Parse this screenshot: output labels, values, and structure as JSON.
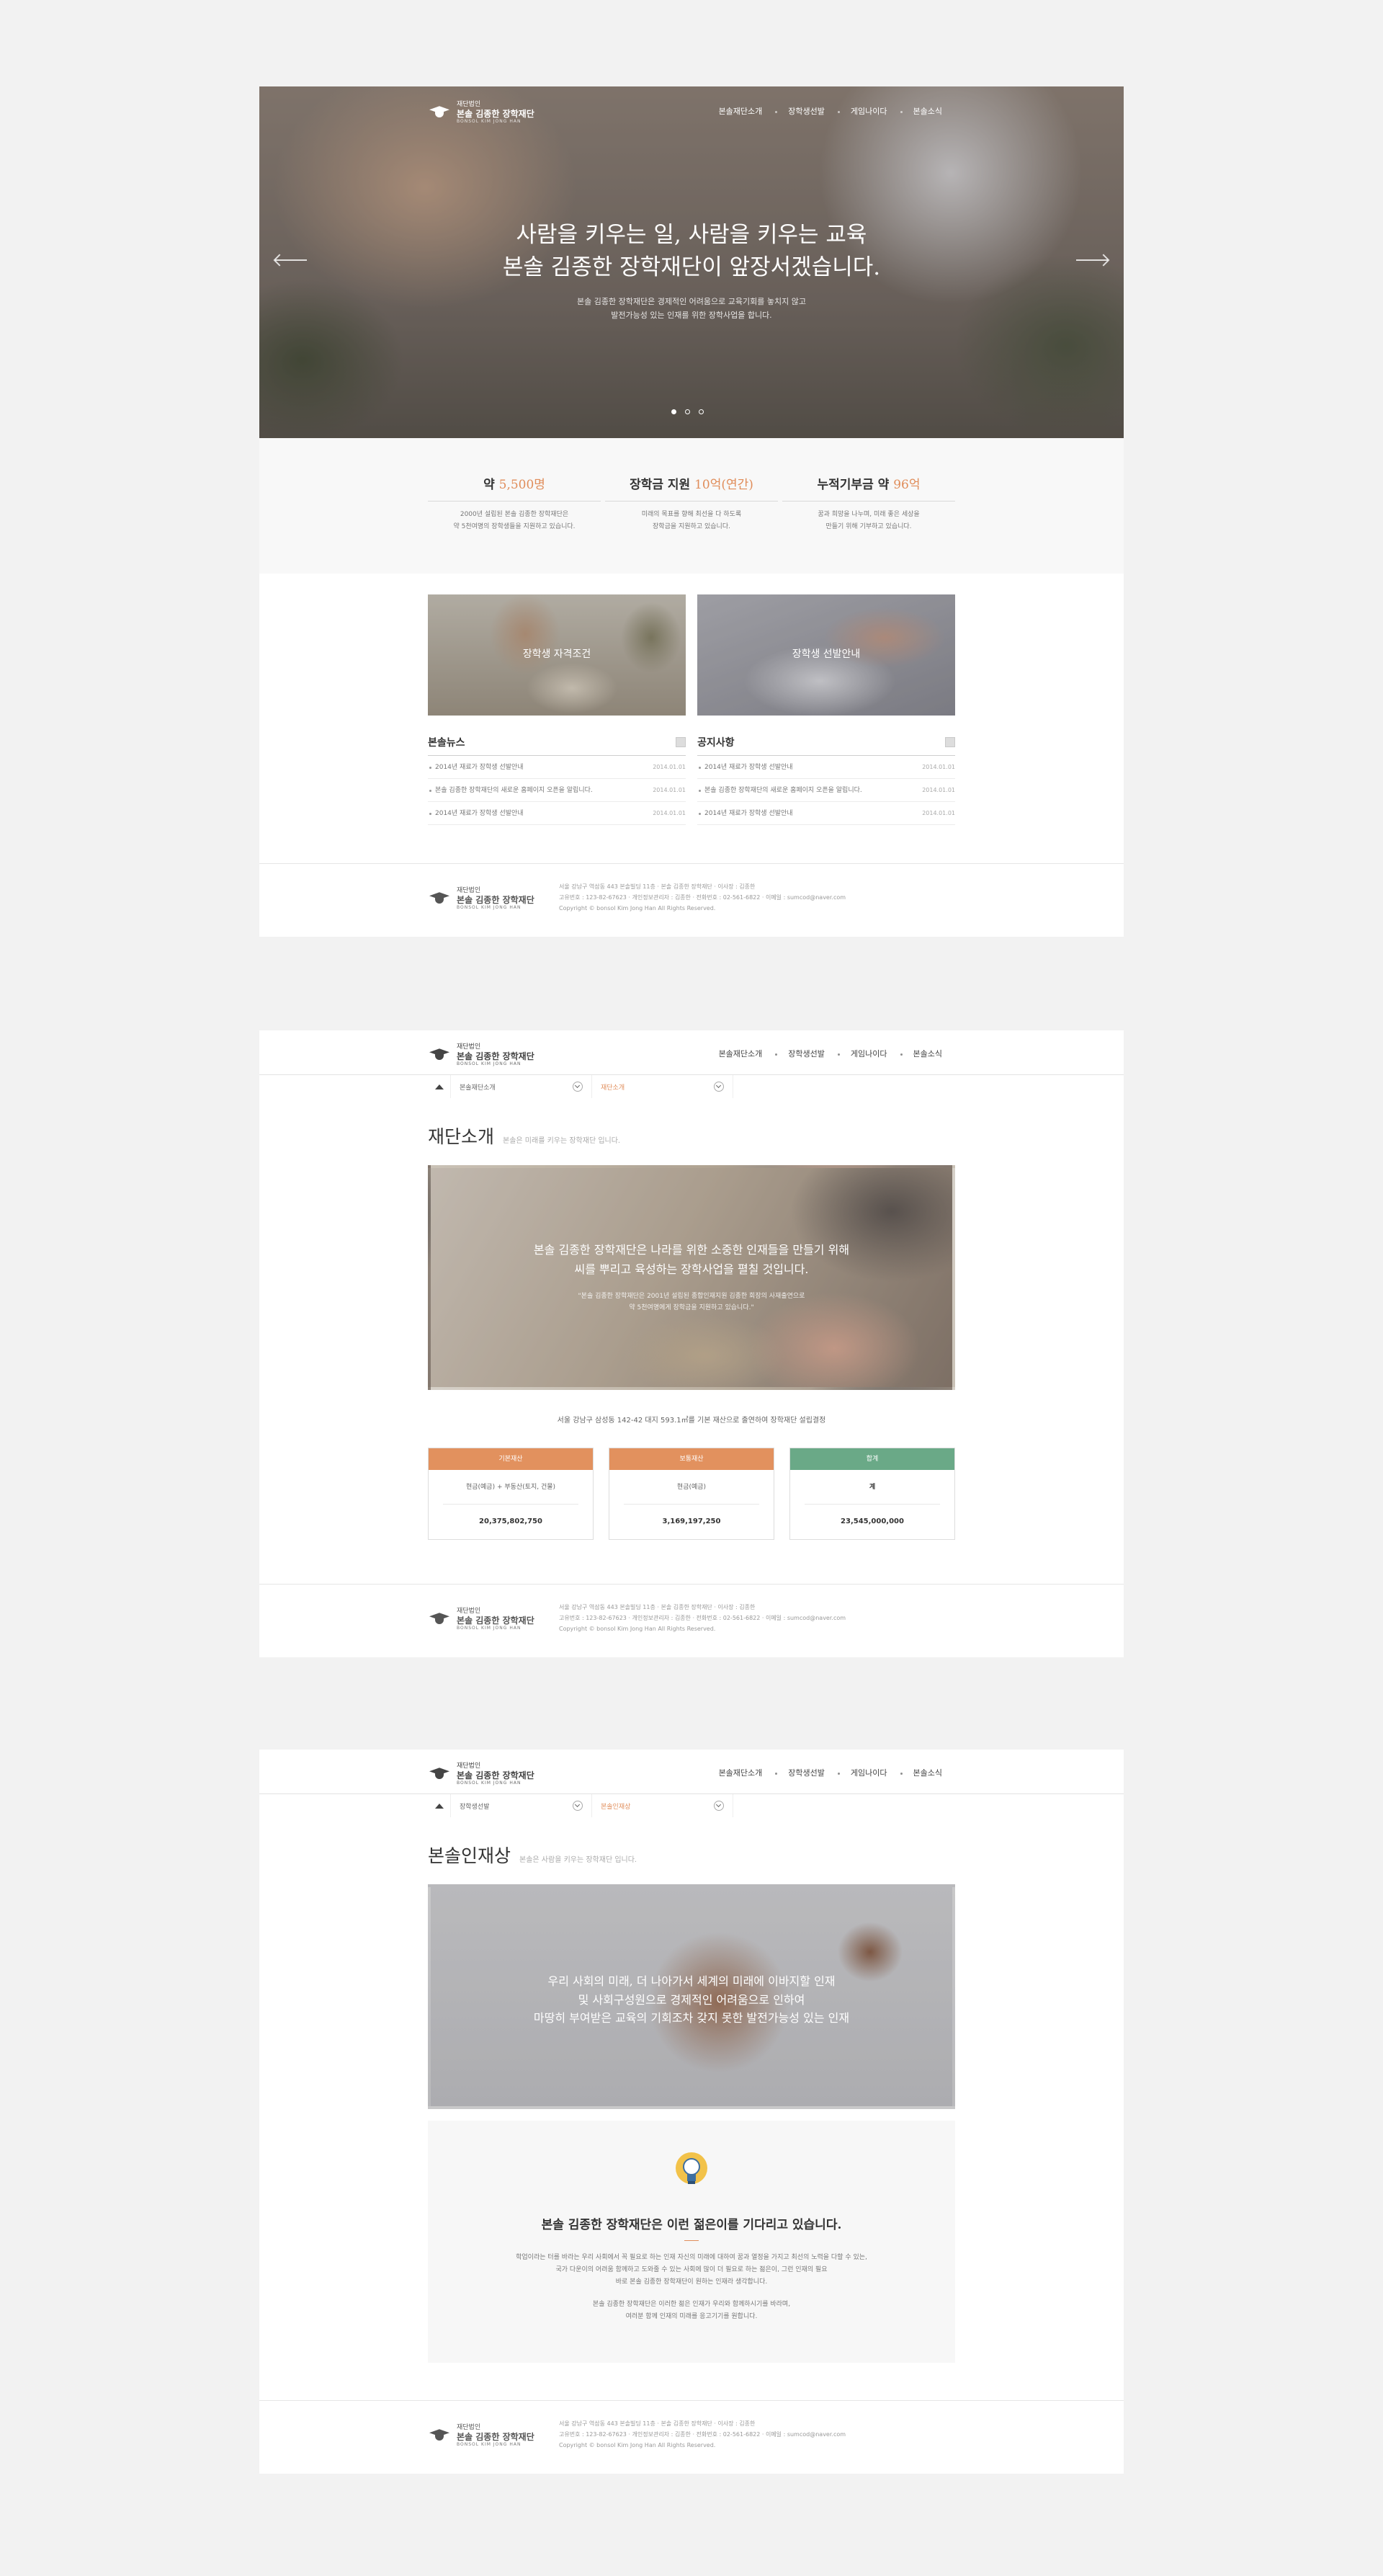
{
  "logo": {
    "line1": "재단법인",
    "line2_a": "본솔 김종한",
    "line2_b": "장학재단",
    "line3": "BONSOL KIM JONG HAN"
  },
  "nav": [
    "본솔재단소개",
    "장학생선발",
    "게임나이다",
    "본솔소식"
  ],
  "page1": {
    "hero": {
      "title_line1": "사람을 키우는 일, 사람을 키우는 교육",
      "title_line2": "본솔 김종한 장학재단이 앞장서겠습니다.",
      "sub_line1": "본솔 김종한 장학재단은 경제적인 어려움으로 교육기회를 놓치지 않고",
      "sub_line2": "발전가능성 있는 인재를 위한 장학사업을 합니다."
    },
    "stats": [
      {
        "label": "약 ",
        "value": "5,500명",
        "desc1": "2000년 설립된 본솔 김종한 장학재단은",
        "desc2": "약 5천여명의 장학생들을 지원하고 있습니다."
      },
      {
        "label": "장학금 지원 ",
        "value": "10억(연간)",
        "desc1": "미래의 목표를 향해 최선을 다 하도록",
        "desc2": "장학금을 지원하고 있습니다."
      },
      {
        "label": "누적기부금 약 ",
        "value": "96억",
        "desc1": "꿈과 희망을 나누며, 미래 좋은 세상을",
        "desc2": "만들기 위해 기부하고 있습니다."
      }
    ],
    "cards": [
      "장학생 자격조건",
      "장학생 선발안내"
    ],
    "news": {
      "title": "본솔뉴스",
      "items": [
        {
          "text": "2014년 재료가 장학생 선발안내",
          "date": "2014.01.01"
        },
        {
          "text": "본솔 김종한 장학재단의 새로운 홈페이지 오픈을 알립니다.",
          "date": "2014.01.01"
        },
        {
          "text": "2014년 재료가 장학생 선발안내",
          "date": "2014.01.01"
        }
      ]
    },
    "notice": {
      "title": "공지사항",
      "items": [
        {
          "text": "2014년 재료가 장학생 선발안내",
          "date": "2014.01.01"
        },
        {
          "text": "본솔 김종한 장학재단의 새로운 홈페이지 오픈을 알립니다.",
          "date": "2014.01.01"
        },
        {
          "text": "2014년 재료가 장학생 선발안내",
          "date": "2014.01.01"
        }
      ]
    }
  },
  "footer": {
    "line1": "서울 강남구 역삼동 443 본솔빌딩 11층 · 본솔 김종한 장학재단 · 이사장 : 김종한",
    "line2": "고유번호 : 123-82-67623 · 개인정보관리자 : 김종한 · 전화번호 : 02-561-6822 · 이메일 : sumcod@naver.com",
    "line3": "Copyright © bonsol Kim Jong Han All Rights Reserved."
  },
  "page2": {
    "crumb": {
      "level1": "본솔재단소개",
      "level2": "재단소개"
    },
    "title": "재단소개",
    "subtitle": "본솔은 미래를 키우는 장학재단 입니다.",
    "banner_line1": "본솔 김종한 장학재단은 나라를 위한 소중한 인재들을 만들기 위해",
    "banner_line2": "씨를 뿌리고 육성하는 장학사업을 펼칠 것입니다.",
    "banner_sub1": "\"본솔 김종한 장학재단은 2001년 설립된 종합인재지원 김종한 회장의 사재출연으로",
    "banner_sub2": "약 5천여명에게 장학금을 지원하고 있습니다.\"",
    "caption": "서울 강남구 삼성동 142-42 대지 593.1㎡를 기본 재산으로 출연하여 장학재단 설립결정",
    "fund": [
      {
        "head": "기본재산",
        "color": "#e2915e",
        "mid": "현금(예금) + 부동산(토지, 건물)",
        "value": "20,375,802,750"
      },
      {
        "head": "보통재산",
        "color": "#e2915e",
        "mid": "현금(예금)",
        "value": "3,169,197,250"
      },
      {
        "head": "합계",
        "color": "#6aa987",
        "mid": "계",
        "value": "23,545,000,000"
      }
    ]
  },
  "page3": {
    "crumb": {
      "level1": "장학생선발",
      "level2": "본솔인재상"
    },
    "title": "본솔인재상",
    "subtitle": "본솔은 사람을 키우는 장학재단 입니다.",
    "banner_line1": "우리 사회의 미래, 더 나아가서 세계의 미래에 이바지할 인재",
    "banner_line2": "및 사회구성원으로 경제적인 어려움으로 인하여",
    "banner_line3": "마땅히 부여받은 교육의 기회조차 갖지 못한 발전가능성 있는 인재",
    "idea_title": "본솔 김종한 장학재단은 이런 젊은이를 기다리고 있습니다.",
    "idea_p1": "학업이라는 터를 바라는 우리 사회에서 꼭 필요로 하는 인재 자신의 미래에 대하여 꿈과 열정을 가지고 최선의 노력을 다할 수 있는,",
    "idea_p2": "국가 다운이의 어려움 함께하고 도와줄 수 있는 사회에 많이 더 필요로 하는 젊은이, 그런 인재의 필요",
    "idea_p3": "바로 본솔 김종한 장학재단이 원하는 인재라 생각합니다.",
    "idea_p4": "본솔 김종한 장학재단은 이러한 젊은 인재가 우리와 함께하시기를 바라며,",
    "idea_p5": "여러분 함께 인재의 미래를 응고기기를 원합니다."
  }
}
